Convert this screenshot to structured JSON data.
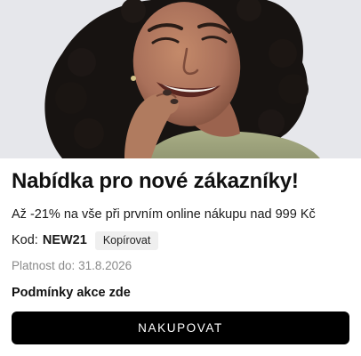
{
  "promo": {
    "title": "Nabídka pro nové zákazníky!",
    "subtitle": "Až -21% na vše při prvním online nákupu nad 999 Kč",
    "code_label": "Kod:",
    "code": "NEW21",
    "copy_label": "Kopírovat",
    "validity_label": "Platnost do:",
    "validity_date": "31.8.2026",
    "terms_link": "Podmínky akce zde",
    "cta_label": "NAKUPOVAT"
  },
  "colors": {
    "cta_background": "#000000",
    "cta_text": "#ffffff",
    "copy_button_bg": "#efefef",
    "muted_text": "#8a8a8a",
    "hero_background": "#e6e7eb"
  }
}
